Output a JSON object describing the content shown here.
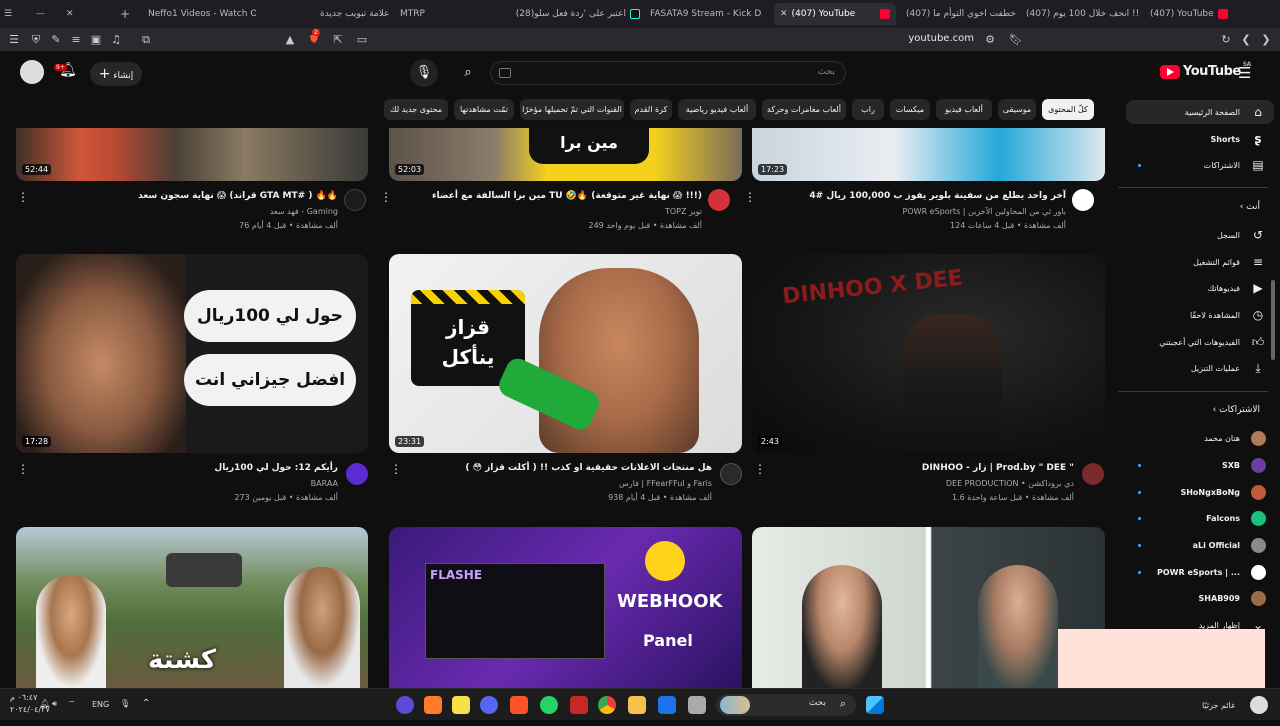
{
  "browser": {
    "tabs": [
      {
        "label": "Neffo1 Videos - Watch O",
        "icon": "kick"
      },
      {
        "label": "علامة تبويب جديدة",
        "icon": "gray"
      },
      {
        "label": "MTRP",
        "icon": "gray"
      },
      {
        "label": "(28)اعتبر على 'ردة فعل سلو",
        "icon": "tiktok"
      },
      {
        "label": "FASATA9 Stream - Kick Da",
        "icon": "kick"
      },
      {
        "label": "(407) YouTube",
        "icon": "youtube",
        "active": true
      },
      {
        "label": "(407) خطفت اخوي التوأم ما",
        "icon": "youtube"
      },
      {
        "label": "(407) انحف خلال 100 يوم !!",
        "icon": "youtube"
      },
      {
        "label": "(407) YouTube",
        "icon": "youtube"
      }
    ],
    "url": "youtube.com",
    "shield_badge": "2"
  },
  "header": {
    "logo_text": "YouTube",
    "logo_region": "SA",
    "search_placeholder": "بحث",
    "create_label": "إنشاء",
    "notifications_badge": "9+"
  },
  "chips": [
    {
      "label": "كلّ المحتوى",
      "selected": true
    },
    {
      "label": "موسيقى"
    },
    {
      "label": "ألعاب فيديو"
    },
    {
      "label": "ميكسات"
    },
    {
      "label": "راب"
    },
    {
      "label": "ألعاب مغامرات وحركة"
    },
    {
      "label": "ألعاب فيديو رياضية"
    },
    {
      "label": "كرة القدم"
    },
    {
      "label": "القنوات التي تمّ تحميلها مؤخرًا"
    },
    {
      "label": "تمّت مشاهدتها"
    },
    {
      "label": "محتوى جديد لك"
    }
  ],
  "sidebar": {
    "main": [
      {
        "label": "الصفحة الرئيسية",
        "icon": "home-icon",
        "active": true
      },
      {
        "label": "Shorts",
        "icon": "shorts-icon"
      },
      {
        "label": "الاشتراكات",
        "icon": "subscriptions-icon",
        "dot": true
      }
    ],
    "you_header": "أنت",
    "you": [
      {
        "label": "السجل",
        "icon": "history-icon"
      },
      {
        "label": "قوائم التشغيل",
        "icon": "playlists-icon"
      },
      {
        "label": "فيديوهاتك",
        "icon": "your-videos-icon"
      },
      {
        "label": "المشاهدة لاحقًا",
        "icon": "watch-later-icon"
      },
      {
        "label": "الفيديوهات التي أعجبتني",
        "icon": "liked-icon"
      },
      {
        "label": "عمليات التنزيل",
        "icon": "downloads-icon"
      }
    ],
    "subs_header": "الاشتراكات",
    "subs": [
      {
        "label": "هتان محمد",
        "color": "#b07a5a",
        "dot": false
      },
      {
        "label": "SXB",
        "color": "#6a3fa0",
        "dot": true
      },
      {
        "label": "SHoNgxBoNg",
        "color": "#c05a3a",
        "dot": true
      },
      {
        "label": "Falcons",
        "color": "#19c37d",
        "dot": true
      },
      {
        "label": "aLi Official",
        "color": "#8a8a8a",
        "dot": true
      },
      {
        "label": "POWR eSports | ...",
        "color": "#ffffff",
        "dot": true
      },
      {
        "label": "SHAB909",
        "color": "#9a6b4a",
        "dot": false
      }
    ],
    "show_more": "إظهار المزيد"
  },
  "videos": {
    "row1": [
      {
        "title": "آخر واحد يطلع من سفينة بلوير يفوز ب 100,000 ريال #4",
        "channel": "POWR eSports | باور ئي من المحاولين الآخرين",
        "meta": "124 ألف مشاهدة • قبل 4 ساعات",
        "duration": "17:23",
        "avatar_color": "#ffffff"
      },
      {
        "title": "مين برا السالفة مع أعضاء TU 🤣🔥 (نهاية غير متوقعة 😱 !!!)",
        "channel": "TOPZ تويز",
        "meta": "249 ألف مشاهدة • قبل يوم واحد",
        "duration": "52:03",
        "avatar_color": "#d4323a"
      },
      {
        "title": "نهاية سجون سعد 😱 (قراند GTA MT# ) 🔥🔥",
        "channel": "فهد سعد - Gaming",
        "meta": "76 ألف مشاهدة • قبل 4 أيام",
        "duration": "52:44",
        "avatar_color": "#1c1c1c"
      }
    ],
    "row2": [
      {
        "title": "DINHOO - زار | Prod.by \" DEE \"",
        "channel": "DEE PRODUCTION • دي بروداكشن",
        "meta": "1.6 ألف مشاهدة • قبل ساعة واحدة",
        "duration": "2:43",
        "avatar_color": "#7a2a2a",
        "thumb_text": "DINHOO X DEE"
      },
      {
        "title": "هل منتجات الاعلانات حقيقية او كذب !! ( أكلت قزاز 😳 )",
        "channel": "فارس | FFearFFul و Faris",
        "meta": "938 ألف مشاهدة • قبل 4 أيام",
        "duration": "23:31",
        "avatar_color": "#2a2a2a",
        "thumb_text": "قزاز ينأكل"
      },
      {
        "title": "رأيكم 12: حول لي 100ريال",
        "channel": "BARAA",
        "meta": "273 ألف مشاهدة • قبل يومين",
        "duration": "17:28",
        "avatar_color": "#5b2bd4",
        "thumb_line1": "حول لي 100ريال",
        "thumb_line2": "افضل جيزاني انت"
      }
    ],
    "row3": [
      {
        "thumb_text": ""
      },
      {
        "thumb_text": "FLASHE",
        "thumb_webhook": "WEBHOOK",
        "thumb_panel": "Panel"
      },
      {
        "thumb_text": "كشتة"
      }
    ]
  },
  "taskbar": {
    "search_label": "بحث",
    "lang": "ENG",
    "time": "٠٦:٤٧ م",
    "date": "٢٠٢٤/٠٤/٢٧",
    "weather_label": "غائم جزئيًا"
  }
}
